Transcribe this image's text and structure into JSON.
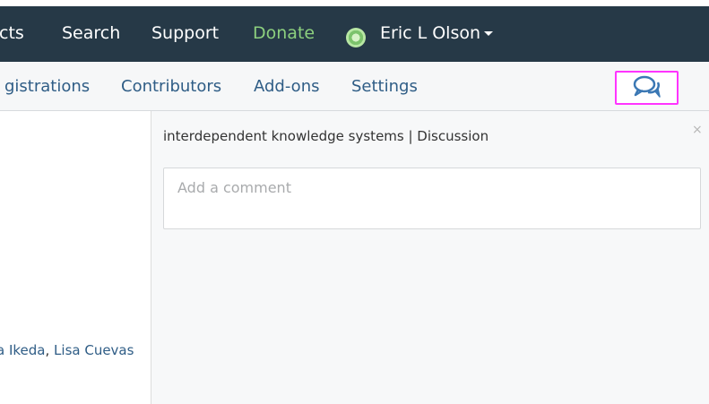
{
  "topbar": {
    "nav_items": [
      "cts",
      "Search",
      "Support",
      "Donate"
    ],
    "user_name": "Eric L Olson"
  },
  "subnav": {
    "tabs": [
      "gistrations",
      "Contributors",
      "Add-ons",
      "Settings"
    ],
    "comments_icon": "chat-bubbles-icon"
  },
  "contributors": {
    "names": [
      "a Ikeda",
      "Lisa Cuevas"
    ],
    "separator": ","
  },
  "comments": {
    "title": "interdependent knowledge systems | Discussion",
    "close_label": "×",
    "placeholder": "Add a comment"
  },
  "colors": {
    "topbar_bg": "#263947",
    "donate": "#8ccf7e",
    "link": "#2f5d86",
    "highlight": "#ff34ff"
  }
}
